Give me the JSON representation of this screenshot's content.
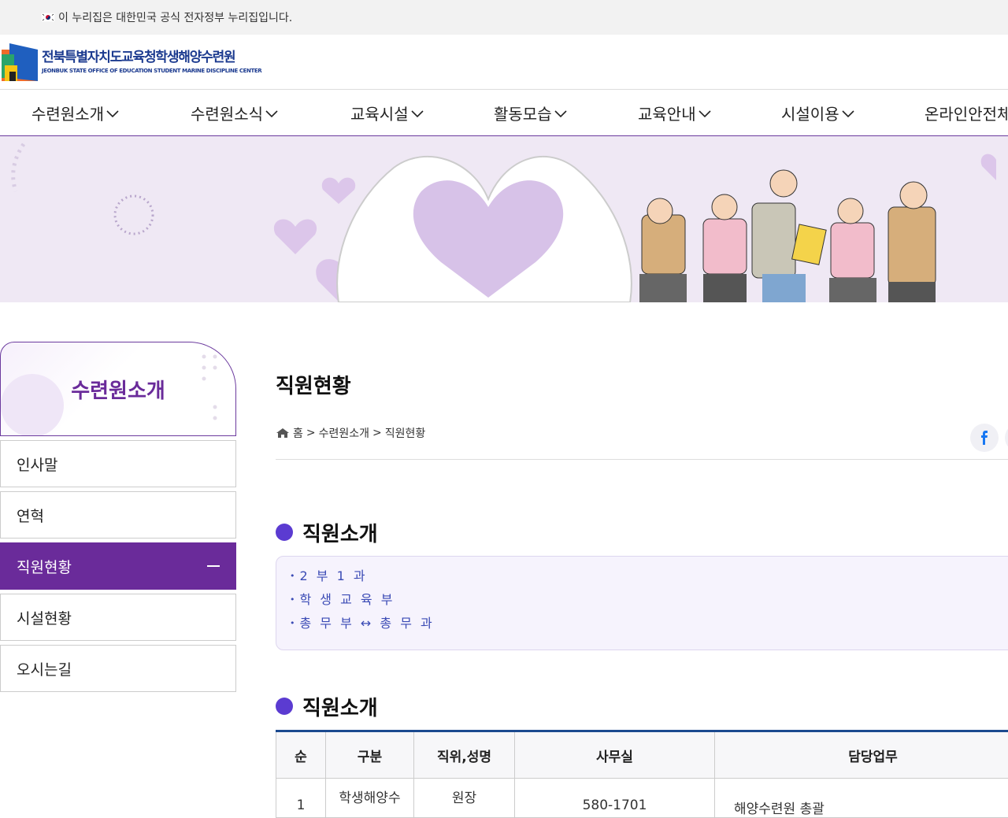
{
  "gov_banner": {
    "text": "이 누리집은 대한민국 공식 전자정부 누리집입니다."
  },
  "logo": {
    "name_kr": "전북특별자치도교육청학생해양수련원",
    "name_en": "JEONBUK STATE OFFICE  OF EDUCATION STUDENT MARINE DISCIPLINE CENTER"
  },
  "gnb": {
    "items": [
      {
        "label": "수련원소개"
      },
      {
        "label": "수련원소식"
      },
      {
        "label": "교육시설"
      },
      {
        "label": "활동모습"
      },
      {
        "label": "교육안내"
      },
      {
        "label": "시설이용"
      },
      {
        "label": "온라인안전체"
      }
    ]
  },
  "lnb": {
    "title": "수련원소개",
    "items": [
      {
        "label": "인사말"
      },
      {
        "label": "연혁"
      },
      {
        "label": "직원현황",
        "active": true
      },
      {
        "label": "시설현황"
      },
      {
        "label": "오시는길"
      }
    ]
  },
  "page": {
    "title": "직원현황",
    "breadcrumb": {
      "home": "홈",
      "sep": ">",
      "level1": "수련원소개",
      "level2": "직원현황"
    }
  },
  "section1": {
    "title": "직원소개",
    "org_links": [
      "2 부 1 과",
      "학 생 교 육 부",
      "총 무 부 ↔ 총 무 과"
    ]
  },
  "section2": {
    "title": "직원소개",
    "table": {
      "headers": [
        "순",
        "구분",
        "직위,성명",
        "사무실",
        "담당업무"
      ],
      "rows": [
        [
          "1",
          "학생해양수",
          "원장",
          "580-1701",
          "해양수련원 총괄"
        ]
      ]
    }
  },
  "colors": {
    "brand_purple": "#6a2b9a",
    "brand_navy": "#1b3a8f",
    "accent_blue": "#3b4bb5"
  }
}
